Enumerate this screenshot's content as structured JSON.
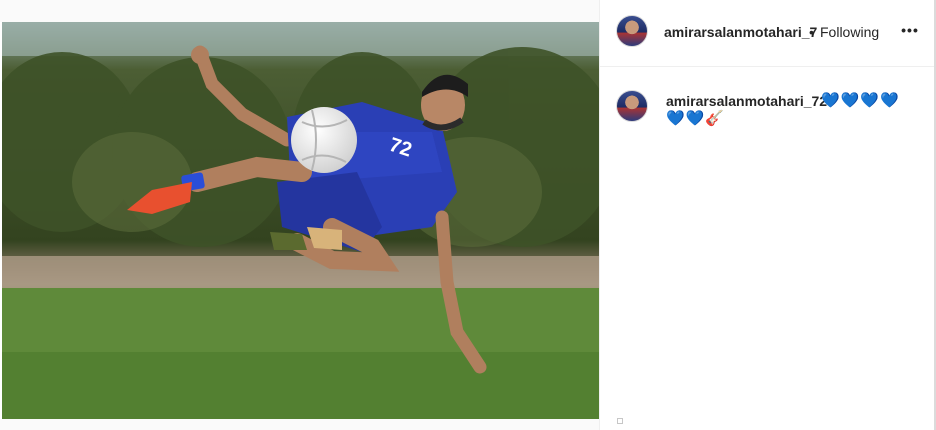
{
  "post": {
    "author": "amirarsalanmotahari_7",
    "separator": "•",
    "follow_state": "Following",
    "more_label": "•••",
    "image_alt": "Soccer player in blue kit performing a bicycle kick on grass"
  },
  "comment": {
    "username": "amirarsalanmotahari_72",
    "emoji_line1": "💙💙💙💙",
    "emoji_line2": "💙💙",
    "emoji_guitar": "🎸"
  },
  "colors": {
    "accent_blue": "#1877f2",
    "kit_blue": "#2a3fb5",
    "grass": "#5f8a3a"
  }
}
